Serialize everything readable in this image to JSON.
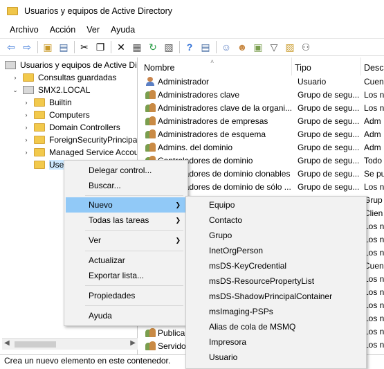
{
  "window": {
    "title": "Usuarios y equipos de Active Directory"
  },
  "menubar": [
    "Archivo",
    "Acción",
    "Ver",
    "Ayuda"
  ],
  "tree": {
    "root": "Usuarios y equipos de Active Dir",
    "saved_queries": "Consultas guardadas",
    "domain": "SMX2.LOCAL",
    "children": [
      "Builtin",
      "Computers",
      "Domain Controllers",
      "ForeignSecurityPrincipals",
      "Managed Service Accour",
      "User"
    ]
  },
  "list": {
    "columns": [
      "Nombre",
      "Tipo",
      "Desc"
    ],
    "rows": [
      {
        "name": "Administrador",
        "type": "Usuario",
        "desc": "Cuen",
        "icon": "user"
      },
      {
        "name": "Administradores clave",
        "type": "Grupo de segu...",
        "desc": "Los n",
        "icon": "group"
      },
      {
        "name": "Administradores clave de la organi...",
        "type": "Grupo de segu...",
        "desc": "Los n",
        "icon": "group"
      },
      {
        "name": "Administradores de empresas",
        "type": "Grupo de segu...",
        "desc": "Adm",
        "icon": "group"
      },
      {
        "name": "Administradores de esquema",
        "type": "Grupo de segu...",
        "desc": "Adm",
        "icon": "group"
      },
      {
        "name": "Admins. del dominio",
        "type": "Grupo de segu...",
        "desc": "Adm",
        "icon": "group"
      },
      {
        "name": "Controladores de dominio",
        "type": "Grupo de segu...",
        "desc": "Todo",
        "icon": "group"
      },
      {
        "name": "Controladores de dominio clonables",
        "type": "Grupo de segu...",
        "desc": "Se pu",
        "icon": "group"
      },
      {
        "name": "Controladores de dominio de sólo ...",
        "type": "Grupo de segu...",
        "desc": "Los n",
        "icon": "group"
      }
    ],
    "extra_desc": [
      "Grup",
      "Clien",
      "Los n",
      "Los n",
      "Los n",
      "Cuen",
      "Los n",
      "Los n",
      "Los n",
      "Los n",
      "Los n",
      "Los n"
    ],
    "bottom_rows": [
      {
        "name": "Publica",
        "icon": "group"
      },
      {
        "name": "Servido",
        "icon": "group"
      }
    ]
  },
  "context_menu": {
    "items": [
      "Delegar control...",
      "Buscar...",
      "Nuevo",
      "Todas las tareas",
      "Ver",
      "Actualizar",
      "Exportar lista...",
      "Propiedades",
      "Ayuda"
    ]
  },
  "submenu": {
    "items": [
      "Equipo",
      "Contacto",
      "Grupo",
      "InetOrgPerson",
      "msDS-KeyCredential",
      "msDS-ResourcePropertyList",
      "msDS-ShadowPrincipalContainer",
      "msImaging-PSPs",
      "Alias de cola de MSMQ",
      "Impresora",
      "Usuario"
    ]
  },
  "status": {
    "text": "Crea un nuevo elemento en este contenedor."
  },
  "colors": {
    "highlight": "#91c9f7",
    "menu_bg": "#f2f2f2",
    "selected_tree": "#cce8ff"
  }
}
